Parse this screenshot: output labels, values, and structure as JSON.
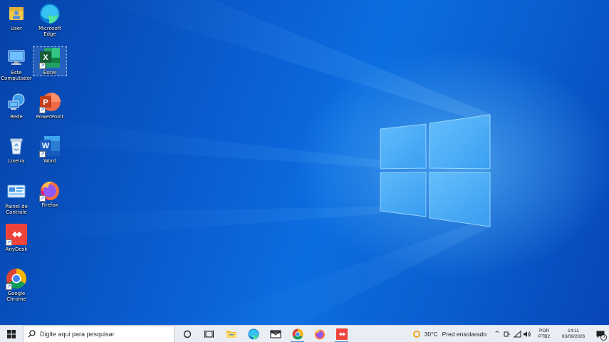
{
  "desktop": {
    "icons_col1": [
      {
        "id": "user",
        "label": "User"
      },
      {
        "id": "computer",
        "label": "Este Computador"
      },
      {
        "id": "network",
        "label": "Rede"
      },
      {
        "id": "recycle",
        "label": "Lixeira"
      },
      {
        "id": "control",
        "label": "Painel de Controle"
      },
      {
        "id": "anydesk",
        "label": "AnyDesk"
      },
      {
        "id": "chrome",
        "label": "Google Chrome"
      }
    ],
    "icons_col2": [
      {
        "id": "edge",
        "label": "Microsoft Edge"
      },
      {
        "id": "excel",
        "label": "Excel"
      },
      {
        "id": "powerpoint",
        "label": "PowerPoint"
      },
      {
        "id": "word",
        "label": "Word"
      },
      {
        "id": "firefox",
        "label": "Firefox"
      }
    ],
    "selected_icon": "excel"
  },
  "taskbar": {
    "search_placeholder": "Digite aqui para pesquisar",
    "pinned": [
      "cortana-icon",
      "task-view-icon",
      "file-explorer-icon",
      "edge-icon",
      "mail-icon",
      "chrome-icon",
      "firefox-icon",
      "anydesk-icon"
    ],
    "weather": {
      "temp": "30°C",
      "desc": "Pred ensolarado"
    },
    "language": {
      "line1": "POR",
      "line2": "PTB2"
    },
    "clock": {
      "time": "14:11",
      "date": "03/09/2026"
    },
    "notification_count": "6",
    "colors": {
      "taskbar_bg": "#e9eef5",
      "accent": "#4a8cd8"
    }
  }
}
